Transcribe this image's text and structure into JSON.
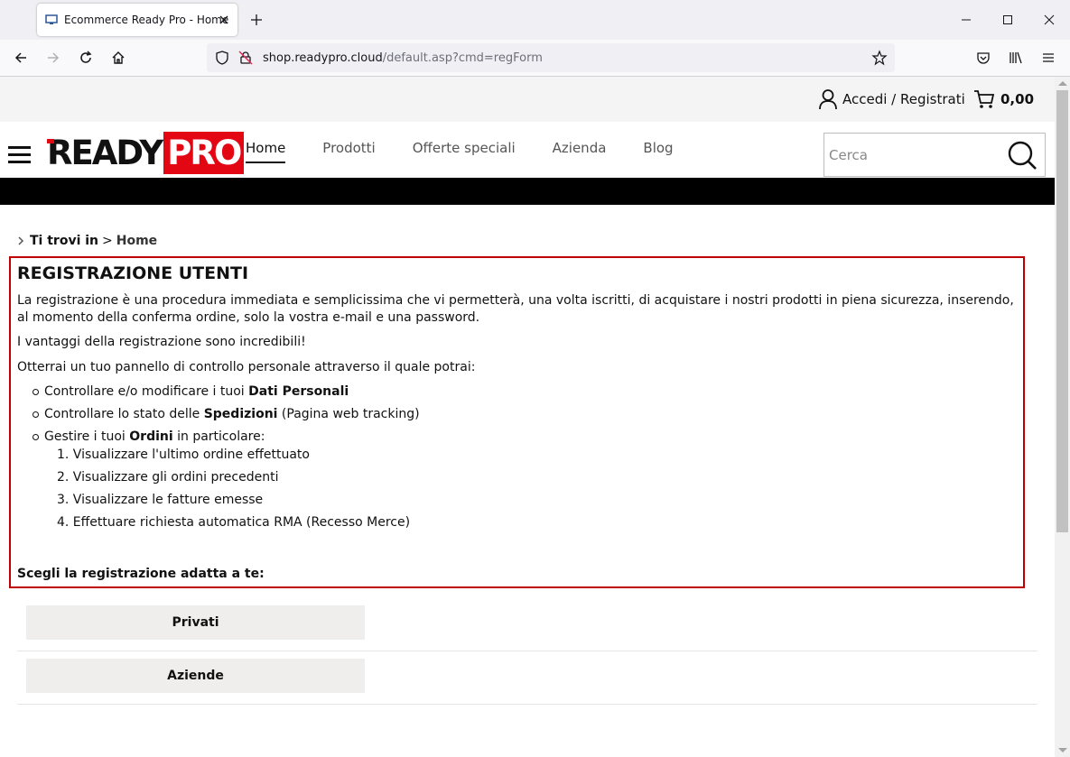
{
  "browser": {
    "tab_title": "Ecommerce Ready Pro - Home",
    "url_domain": "shop.readypro.cloud",
    "url_path": "/default.asp?cmd=regForm"
  },
  "topbar": {
    "account_label": "Accedi / Registrati",
    "cart_total": "0,00"
  },
  "logo": {
    "part1": "READY",
    "part2": "PRO"
  },
  "menu": {
    "items": [
      {
        "label": "Home",
        "active": true
      },
      {
        "label": "Prodotti"
      },
      {
        "label": "Offerte speciali"
      },
      {
        "label": "Azienda"
      },
      {
        "label": "Blog"
      }
    ]
  },
  "search": {
    "placeholder": "Cerca"
  },
  "breadcrumb": {
    "label": "Ti trovi in",
    "separator": ">",
    "current": "Home"
  },
  "registration": {
    "title": "REGISTRAZIONE UTENTI",
    "intro": "La registrazione è una procedura immediata e semplicissima che vi permetterà, una volta iscritti, di acquistare i nostri prodotti in piena sicurezza, inserendo, al momento della conferma ordine, solo la vostra e-mail e una password.",
    "advantages": "I vantaggi della registrazione sono incredibili!",
    "panel_intro": "Otterrai un tuo pannello di controllo personale attraverso il quale potrai:",
    "bullets": [
      {
        "pre": "Controllare e/o modificare i tuoi ",
        "bold": "Dati Personali",
        "post": ""
      },
      {
        "pre": "Controllare lo stato delle ",
        "bold": "Spedizioni",
        "post": " (Pagina web tracking)"
      },
      {
        "pre": "Gestire i tuoi ",
        "bold": "Ordini",
        "post": " in particolare:"
      }
    ],
    "order_items": [
      "1. Visualizzare l'ultimo ordine effettuato",
      "2. Visualizzare gli ordini precedenti",
      "3. Visualizzare le fatture emesse",
      "4. Effettuare richiesta automatica RMA (Recesso Merce)"
    ],
    "choose": "Scegli la registrazione adatta a te:"
  },
  "options": {
    "private": "Privati",
    "company": "Aziende"
  },
  "colors": {
    "accent_red": "#e30613",
    "box_border": "#c00000",
    "button_bg": "#efeeec"
  }
}
